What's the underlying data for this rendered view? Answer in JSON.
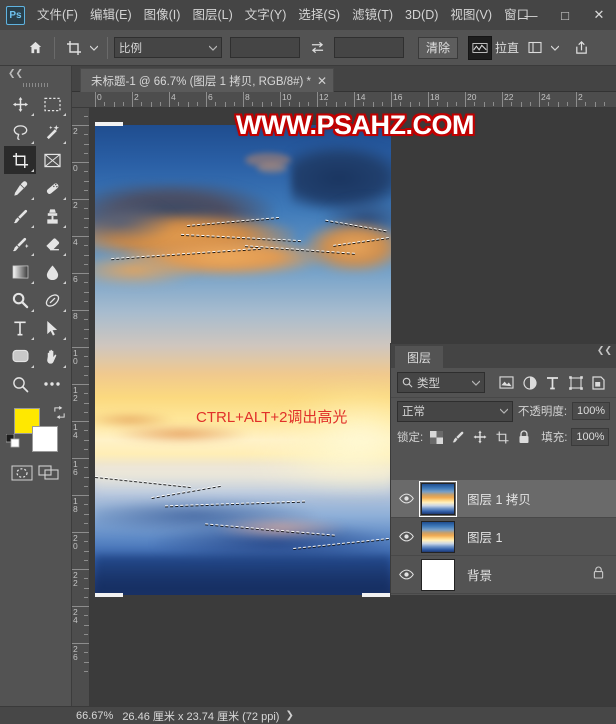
{
  "app": {
    "logo_text": "Ps"
  },
  "menubar": {
    "items": [
      {
        "label": "文件(F)",
        "name": "menu-file"
      },
      {
        "label": "编辑(E)",
        "name": "menu-edit"
      },
      {
        "label": "图像(I)",
        "name": "menu-image"
      },
      {
        "label": "图层(L)",
        "name": "menu-layer"
      },
      {
        "label": "文字(Y)",
        "name": "menu-type"
      },
      {
        "label": "选择(S)",
        "name": "menu-select"
      },
      {
        "label": "滤镜(T)",
        "name": "menu-filter"
      },
      {
        "label": "3D(D)",
        "name": "menu-3d"
      },
      {
        "label": "视图(V)",
        "name": "menu-view"
      },
      {
        "label": "窗口",
        "name": "menu-window"
      }
    ],
    "window_controls": {
      "minimize": "—",
      "maximize": "□",
      "close": "✕"
    }
  },
  "optionsbar": {
    "ratio_select": "比例",
    "width_value": "",
    "height_value": "",
    "clear_button": "清除",
    "straighten_label": "拉直"
  },
  "tools": {
    "items": [
      {
        "name": "move-tool",
        "label": "移动工具"
      },
      {
        "name": "marquee-tool",
        "label": "矩形选框工具"
      },
      {
        "name": "lasso-tool",
        "label": "套索工具"
      },
      {
        "name": "magic-wand-tool",
        "label": "魔棒工具"
      },
      {
        "name": "crop-tool",
        "label": "裁剪工具"
      },
      {
        "name": "frame-tool",
        "label": "画框工具"
      },
      {
        "name": "eyedropper-tool",
        "label": "吸管工具"
      },
      {
        "name": "healing-brush-tool",
        "label": "修复画笔工具"
      },
      {
        "name": "brush-tool",
        "label": "画笔工具"
      },
      {
        "name": "clone-stamp-tool",
        "label": "仿制图章工具"
      },
      {
        "name": "history-brush-tool",
        "label": "历史记录画笔工具"
      },
      {
        "name": "eraser-tool",
        "label": "橡皮擦工具"
      },
      {
        "name": "gradient-tool",
        "label": "渐变工具"
      },
      {
        "name": "blur-tool",
        "label": "模糊工具"
      },
      {
        "name": "dodge-tool",
        "label": "减淡工具"
      },
      {
        "name": "pen-tool",
        "label": "钢笔工具"
      },
      {
        "name": "type-tool",
        "label": "横排文字工具"
      },
      {
        "name": "path-selection-tool",
        "label": "路径选择工具"
      },
      {
        "name": "rectangle-tool",
        "label": "矩形工具"
      },
      {
        "name": "hand-tool",
        "label": "抓手工具"
      },
      {
        "name": "zoom-tool",
        "label": "缩放工具"
      },
      {
        "name": "edit-toolbar-tool",
        "label": "编辑工具栏"
      }
    ],
    "selected": "crop-tool",
    "foreground_color": "#FFE800",
    "background_color": "#FFFFFF"
  },
  "document": {
    "tab_title": "未标题-1 @ 66.7% (图层 1 拷贝, RGB/8#) *",
    "tab_close": "✕",
    "watermark_text": "WWW.PSAHZ.COM",
    "watermark_color": "#FFFFFF",
    "watermark_outline_color": "#C00000",
    "annotation_text": "CTRL+ALT+2调出高光",
    "annotation_color": "#E0302A"
  },
  "rulers": {
    "horizontal_labels": [
      "0",
      "2",
      "4",
      "6",
      "8",
      "10",
      "12",
      "14",
      "16",
      "18",
      "20",
      "22",
      "24",
      "2"
    ],
    "vertical_labels": [
      "4",
      "2",
      "0",
      "2",
      "4",
      "6",
      "8",
      "10",
      "12",
      "14",
      "16",
      "18",
      "20",
      "22",
      "24",
      "26"
    ],
    "unit": "厘米"
  },
  "statusbar": {
    "zoom": "66.67%",
    "dimensions": "26.46 厘米 x 23.74 厘米 (72 ppi)",
    "arrow": "❯"
  },
  "layers_panel": {
    "tab_label": "图层",
    "collapse_icon": "❮❮",
    "filter_select": "类型",
    "filter_icons": [
      {
        "name": "filter-pixel-icon",
        "label": "像素图层"
      },
      {
        "name": "filter-adjustment-icon",
        "label": "调整图层"
      },
      {
        "name": "filter-type-icon",
        "label": "文字图层"
      },
      {
        "name": "filter-shape-icon",
        "label": "形状图层"
      },
      {
        "name": "filter-smart-object-icon",
        "label": "智能对象"
      }
    ],
    "blend_mode": "正常",
    "opacity_label": "不透明度:",
    "opacity_value": "100%",
    "lock_label": "锁定:",
    "lock_icons": [
      {
        "name": "lock-transparent-pixels-icon",
        "label": "锁定透明像素"
      },
      {
        "name": "lock-image-pixels-icon",
        "label": "锁定图像像素"
      },
      {
        "name": "lock-position-icon",
        "label": "锁定位置"
      },
      {
        "name": "lock-artboard-icon",
        "label": "防止画板嵌套"
      },
      {
        "name": "lock-all-icon",
        "label": "锁定全部"
      }
    ],
    "fill_label": "填充:",
    "fill_value": "100%",
    "layers": [
      {
        "name": "图层 1 拷贝",
        "selected": true,
        "visible": true,
        "locked": false,
        "thumb": "image"
      },
      {
        "name": "图层 1",
        "selected": false,
        "visible": true,
        "locked": false,
        "thumb": "image"
      },
      {
        "name": "背景",
        "selected": false,
        "visible": true,
        "locked": true,
        "thumb": "white"
      }
    ]
  }
}
